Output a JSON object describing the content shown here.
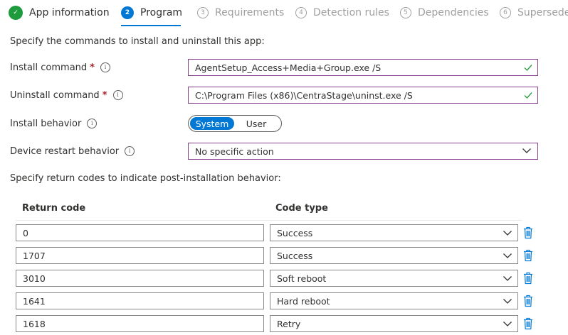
{
  "steps": [
    {
      "num": "✓",
      "label": "App information",
      "state": "done"
    },
    {
      "num": "2",
      "label": "Program",
      "state": "active"
    },
    {
      "num": "3",
      "label": "Requirements",
      "state": "todo"
    },
    {
      "num": "4",
      "label": "Detection rules",
      "state": "todo"
    },
    {
      "num": "5",
      "label": "Dependencies",
      "state": "todo"
    },
    {
      "num": "6",
      "label": "Superseder",
      "state": "todo"
    }
  ],
  "intro": "Specify the commands to install and uninstall this app:",
  "install": {
    "label": "Install command",
    "value": "AgentSetup_Access+Media+Group.exe /S"
  },
  "uninstall": {
    "label": "Uninstall command",
    "value": "C:\\Program Files (x86)\\CentraStage\\uninst.exe /S"
  },
  "required_mark": "*",
  "info_glyph": "i",
  "behavior": {
    "label": "Install behavior",
    "options": [
      "System",
      "User"
    ],
    "selected": "System"
  },
  "restart": {
    "label": "Device restart behavior",
    "value": "No specific action"
  },
  "return_intro": "Specify return codes to indicate post-installation behavior:",
  "table": {
    "headers": {
      "code": "Return code",
      "type": "Code type"
    },
    "rows": [
      {
        "code": "0",
        "type": "Success"
      },
      {
        "code": "1707",
        "type": "Success"
      },
      {
        "code": "3010",
        "type": "Soft reboot"
      },
      {
        "code": "1641",
        "type": "Hard reboot"
      },
      {
        "code": "1618",
        "type": "Retry"
      }
    ]
  },
  "colors": {
    "accent": "#0078d4",
    "done": "#1e9b3d",
    "field_border": "#8a3f8f",
    "valid": "#2ea043",
    "required": "#a4262c"
  }
}
